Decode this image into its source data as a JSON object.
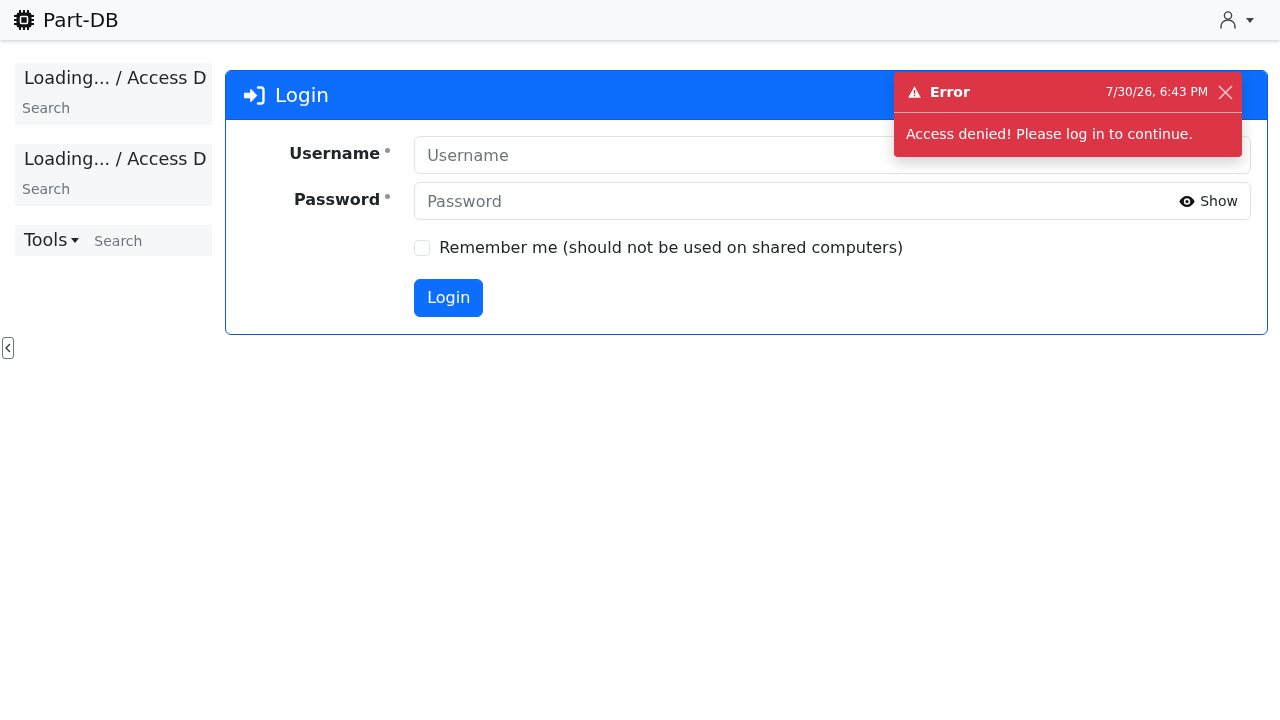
{
  "navbar": {
    "brand": "Part-DB"
  },
  "sidebar": {
    "panels": [
      {
        "kind": "tree",
        "title": "Loading... / Access D",
        "search": {
          "placeholder": "Search"
        }
      },
      {
        "kind": "tree",
        "title": "Loading... / Access D",
        "search": {
          "placeholder": "Search"
        }
      },
      {
        "kind": "dropdown",
        "title": "Tools",
        "search": {
          "placeholder": "Search"
        }
      }
    ]
  },
  "login_card": {
    "title": "Login",
    "fields": [
      {
        "kind": "text",
        "label": "Username",
        "required": true,
        "placeholder": "Username"
      },
      {
        "kind": "password",
        "label": "Password",
        "required": true,
        "placeholder": "Password",
        "toggle_label": "Show"
      }
    ],
    "remember": {
      "label": "Remember me (should not be used on shared computers)",
      "checked": false
    },
    "submit": "Login"
  },
  "toast": {
    "kind": "error",
    "title": "Error",
    "time": "7/30/26, 6:43 PM",
    "message": "Access denied! Please log in to continue."
  }
}
